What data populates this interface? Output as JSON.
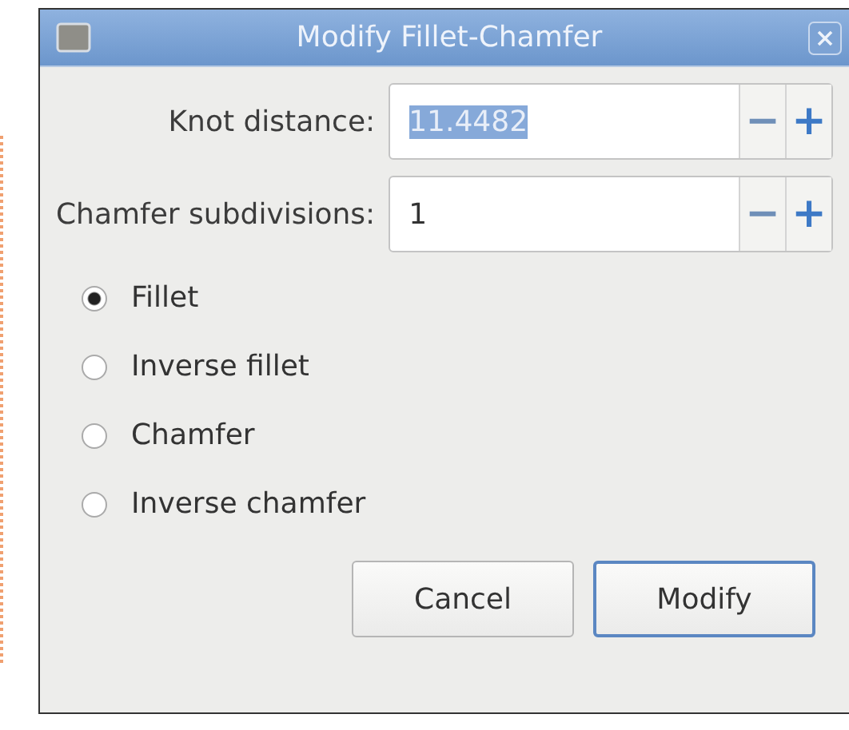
{
  "window": {
    "title": "Modify Fillet-Chamfer"
  },
  "fields": [
    {
      "label": "Knot distance:",
      "value": "11.4482",
      "value_selected": true,
      "decrement": "−",
      "increment": "+"
    },
    {
      "label": "Chamfer subdivisions:",
      "value": "1",
      "value_selected": false,
      "decrement": "−",
      "increment": "+"
    }
  ],
  "options": [
    {
      "label": "Fillet",
      "selected": true
    },
    {
      "label": "Inverse fillet",
      "selected": false
    },
    {
      "label": "Chamfer",
      "selected": false
    },
    {
      "label": "Inverse chamfer",
      "selected": false
    }
  ],
  "buttons": [
    {
      "label": "Cancel",
      "default": false
    },
    {
      "label": "Modify",
      "default": true
    }
  ]
}
